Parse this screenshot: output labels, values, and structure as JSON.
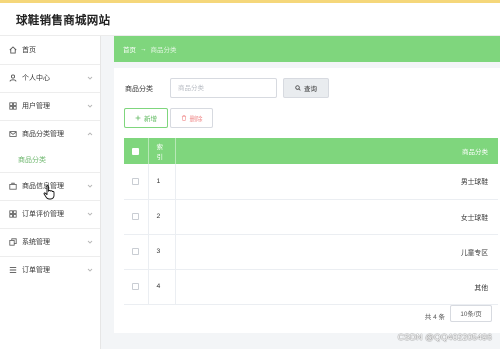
{
  "header": {
    "site_title": "球鞋销售商城网站"
  },
  "sidebar": {
    "items": [
      {
        "label": "首页",
        "icon": "home-icon"
      },
      {
        "label": "个人中心",
        "icon": "user-icon"
      },
      {
        "label": "用户管理",
        "icon": "grid-icon"
      },
      {
        "label": "商品分类管理",
        "icon": "mail-icon",
        "expanded": true,
        "children": [
          {
            "label": "商品分类",
            "active": true
          }
        ]
      },
      {
        "label": "商品信息管理",
        "icon": "briefcase-icon"
      },
      {
        "label": "订单评价管理",
        "icon": "grid-icon"
      },
      {
        "label": "系统管理",
        "icon": "copy-icon"
      },
      {
        "label": "订单管理",
        "icon": "list-icon"
      }
    ]
  },
  "breadcrumb": {
    "home": "首页",
    "separator": "→",
    "current": "商品分类"
  },
  "search": {
    "label": "商品分类",
    "placeholder": "商品分类",
    "value": "",
    "button_label": "查询"
  },
  "toolbar": {
    "add_label": "新增",
    "delete_label": "删除"
  },
  "table": {
    "columns": [
      {
        "label": ""
      },
      {
        "label": "索引"
      },
      {
        "label": "商品分类"
      }
    ],
    "rows": [
      {
        "index": "1",
        "category": "男士球鞋"
      },
      {
        "index": "2",
        "category": "女士球鞋"
      },
      {
        "index": "3",
        "category": "儿童专区"
      },
      {
        "index": "4",
        "category": "其他"
      }
    ]
  },
  "pagination": {
    "total_text": "共 4 条",
    "page_size": "10条/页"
  },
  "watermark": "CSDN @QQ402205496",
  "colors": {
    "accent": "#7fd67d",
    "active_text": "#6ab56a",
    "danger": "#f08a8a"
  }
}
